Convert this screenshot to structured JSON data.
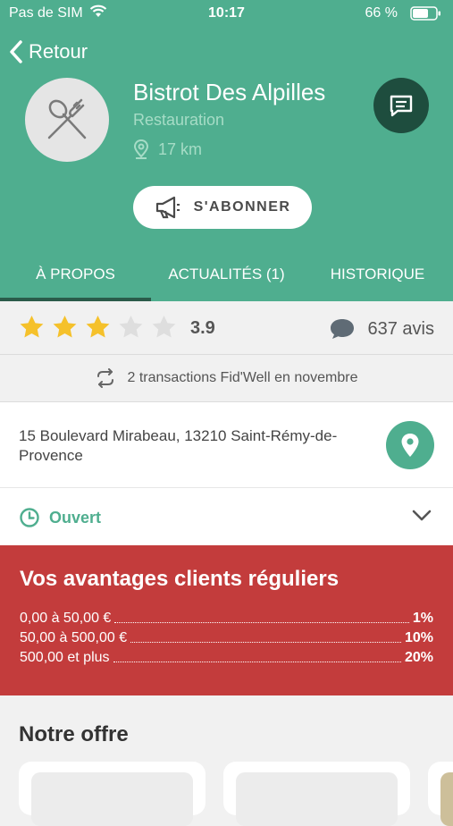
{
  "status_bar": {
    "carrier": "Pas de SIM",
    "time": "10:17",
    "battery": "66 %"
  },
  "nav": {
    "back_label": "Retour"
  },
  "business": {
    "name": "Bistrot Des Alpilles",
    "category": "Restauration",
    "distance": "17 km",
    "logo_icon": "fork-spoon-icon"
  },
  "subscribe_label": "S'ABONNER",
  "tabs": [
    {
      "label": "À PROPOS",
      "active": true
    },
    {
      "label": "ACTUALITÉS (1)",
      "active": false
    },
    {
      "label": "HISTORIQUE",
      "active": false
    }
  ],
  "rating": {
    "stars_filled": 3,
    "stars_total": 5,
    "score": "3.9",
    "reviews": "637 avis"
  },
  "transactions": "2 transactions Fid'Well en novembre",
  "address": "15 Boulevard Mirabeau, 13210 Saint-Rémy-de-Provence",
  "opening": {
    "status": "Ouvert"
  },
  "advantages": {
    "title": "Vos avantages clients réguliers",
    "tiers": [
      {
        "range": "0,00 à 50,00 €",
        "percent": "1%"
      },
      {
        "range": "50,00 à 500,00 €",
        "percent": "10%"
      },
      {
        "range": "500,00 et plus",
        "percent": "20%"
      }
    ]
  },
  "offer": {
    "title": "Notre offre"
  },
  "colors": {
    "primary": "#4fae8f",
    "dark": "#1e4d3e",
    "advantage_red": "#c33c3c",
    "star": "#f5c12b"
  }
}
